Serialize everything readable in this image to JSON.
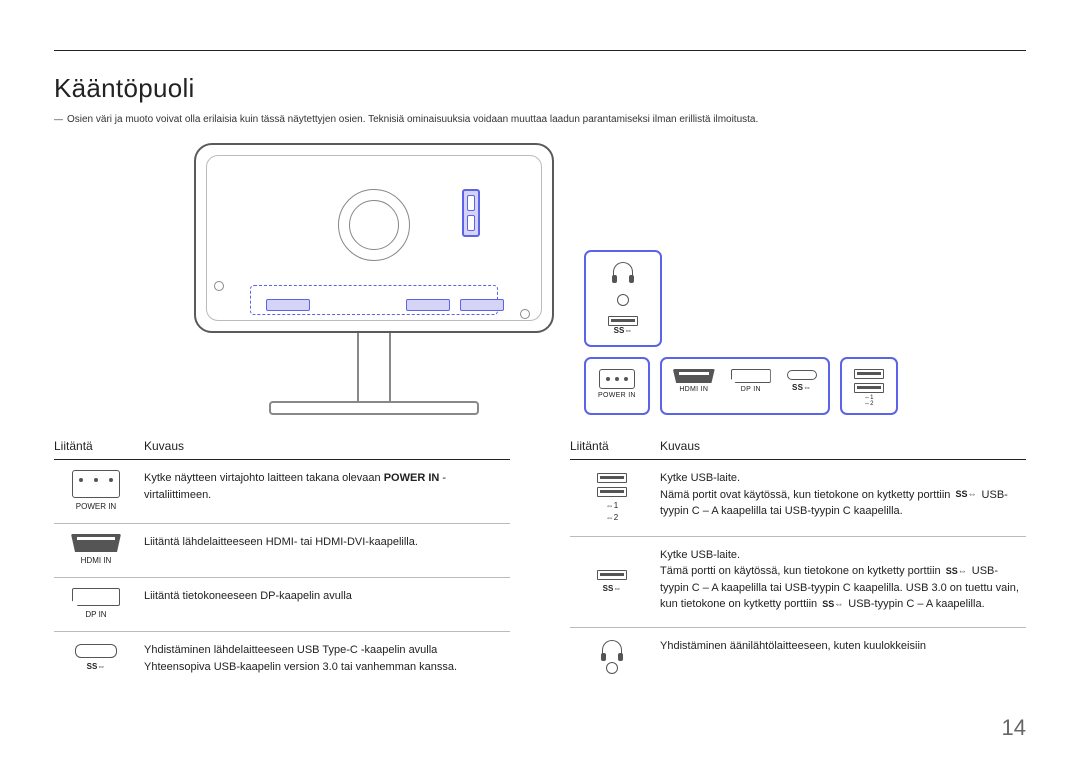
{
  "page": {
    "title": "Kääntöpuoli",
    "note": "Osien väri ja muoto voivat olla erilaisia kuin tässä näytettyjen osien. Teknisiä ominaisuuksia voidaan muuttaa laadun parantamiseksi ilman erillistä ilmoitusta.",
    "page_number": "14"
  },
  "port_labels": {
    "power_in": "POWER IN",
    "hdmi_in": "HDMI IN",
    "dp_in": "DP IN",
    "usbc_ss": "SS⇔",
    "usb12_1": "⇔1",
    "usb12_2": "⇔2"
  },
  "tables": {
    "headers": {
      "port": "Liitäntä",
      "desc": "Kuvaus"
    },
    "left": [
      {
        "icon": "power",
        "label": "POWER IN",
        "desc_pre": "Kytke näytteen virtajohto laitteen takana olevaan ",
        "desc_bold": "POWER IN",
        "desc_post": " -virtaliittimeen."
      },
      {
        "icon": "hdmi",
        "label": "HDMI IN",
        "desc": "Liitäntä lähdelaitteeseen HDMI- tai HDMI-DVI-kaapelilla."
      },
      {
        "icon": "dp",
        "label": "DP IN",
        "desc": "Liitäntä tietokoneeseen DP-kaapelin avulla"
      },
      {
        "icon": "usbc",
        "label": "SS⇔",
        "desc": "Yhdistäminen lähdelaitteeseen USB Type-C -kaapelin avulla Yhteensopiva USB-kaapelin version 3.0 tai vanhemman kanssa."
      }
    ],
    "right": [
      {
        "icon": "usb12",
        "label1": "⇔1",
        "label2": "⇔2",
        "line1": "Kytke USB-laite.",
        "line2_pre": "Nämä portit ovat käytössä, kun tietokone on kytketty porttiin ",
        "line2_ss": "SS⇔",
        "line2_post": " USB-tyypin C – A kaapelilla tai USB-tyypin C kaapelilla."
      },
      {
        "icon": "usbss",
        "label": "SS⇔",
        "line1": "Kytke USB-laite.",
        "line2_pre": "Tämä portti on käytössä, kun tietokone on kytketty porttiin ",
        "line2_ss1": "SS⇔",
        "line2_mid": " USB-tyypin C – A kaapelilla tai USB-tyypin C kaapelilla. USB 3.0 on tuettu vain, kun tietokone on kytketty porttiin ",
        "line2_ss2": "SS⇔",
        "line2_post": " USB-tyypin C – A kaapelilla."
      },
      {
        "icon": "headphone",
        "desc": "Yhdistäminen äänilähtölaitteeseen, kuten kuulokkeisiin"
      }
    ]
  }
}
